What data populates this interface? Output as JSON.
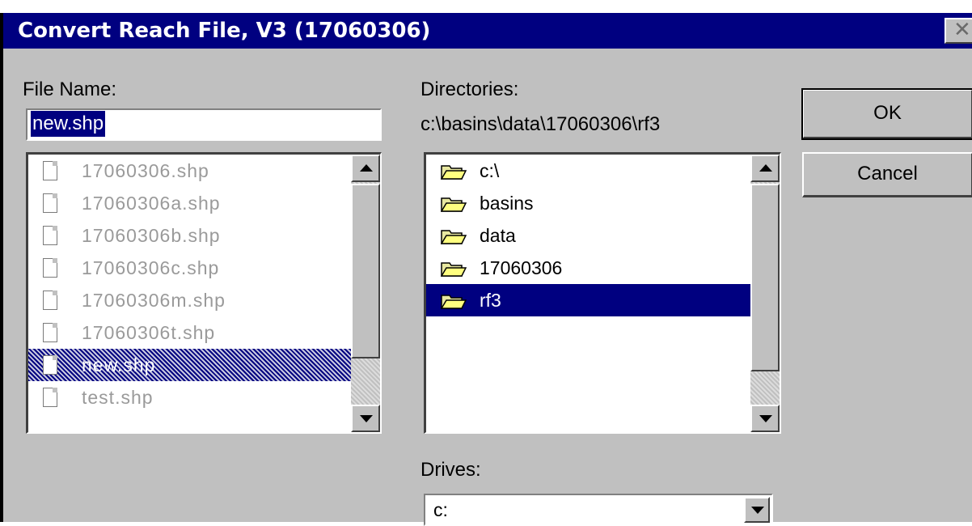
{
  "window": {
    "title": "Convert Reach File, V3 (17060306)",
    "close_glyph": "✕"
  },
  "file_name": {
    "label": "File Name:",
    "value": "new.shp",
    "files": [
      {
        "name": "17060306.shp",
        "selected": false
      },
      {
        "name": "17060306a.shp",
        "selected": false
      },
      {
        "name": "17060306b.shp",
        "selected": false
      },
      {
        "name": "17060306c.shp",
        "selected": false
      },
      {
        "name": "17060306m.shp",
        "selected": false
      },
      {
        "name": "17060306t.shp",
        "selected": false
      },
      {
        "name": "new.shp",
        "selected": true
      },
      {
        "name": "test.shp",
        "selected": false
      }
    ]
  },
  "directories": {
    "label": "Directories:",
    "current_path": "c:\\basins\\data\\17060306\\rf3",
    "items": [
      {
        "name": "c:\\",
        "selected": false
      },
      {
        "name": "basins",
        "selected": false
      },
      {
        "name": "data",
        "selected": false
      },
      {
        "name": "17060306",
        "selected": false
      },
      {
        "name": "rf3",
        "selected": true
      }
    ]
  },
  "drives": {
    "label": "Drives:",
    "selected": "c:"
  },
  "buttons": {
    "ok": "OK",
    "cancel": "Cancel"
  },
  "colors": {
    "titlebar": "#000080",
    "face": "#c0c0c0",
    "highlight": "#000080",
    "folder": "#ffff80"
  },
  "icons": {
    "file": "file-icon",
    "folder": "folder-open-icon",
    "scroll_up": "arrow-up-icon",
    "scroll_down": "arrow-down-icon",
    "dropdown": "chevron-down-icon",
    "close": "close-icon"
  }
}
